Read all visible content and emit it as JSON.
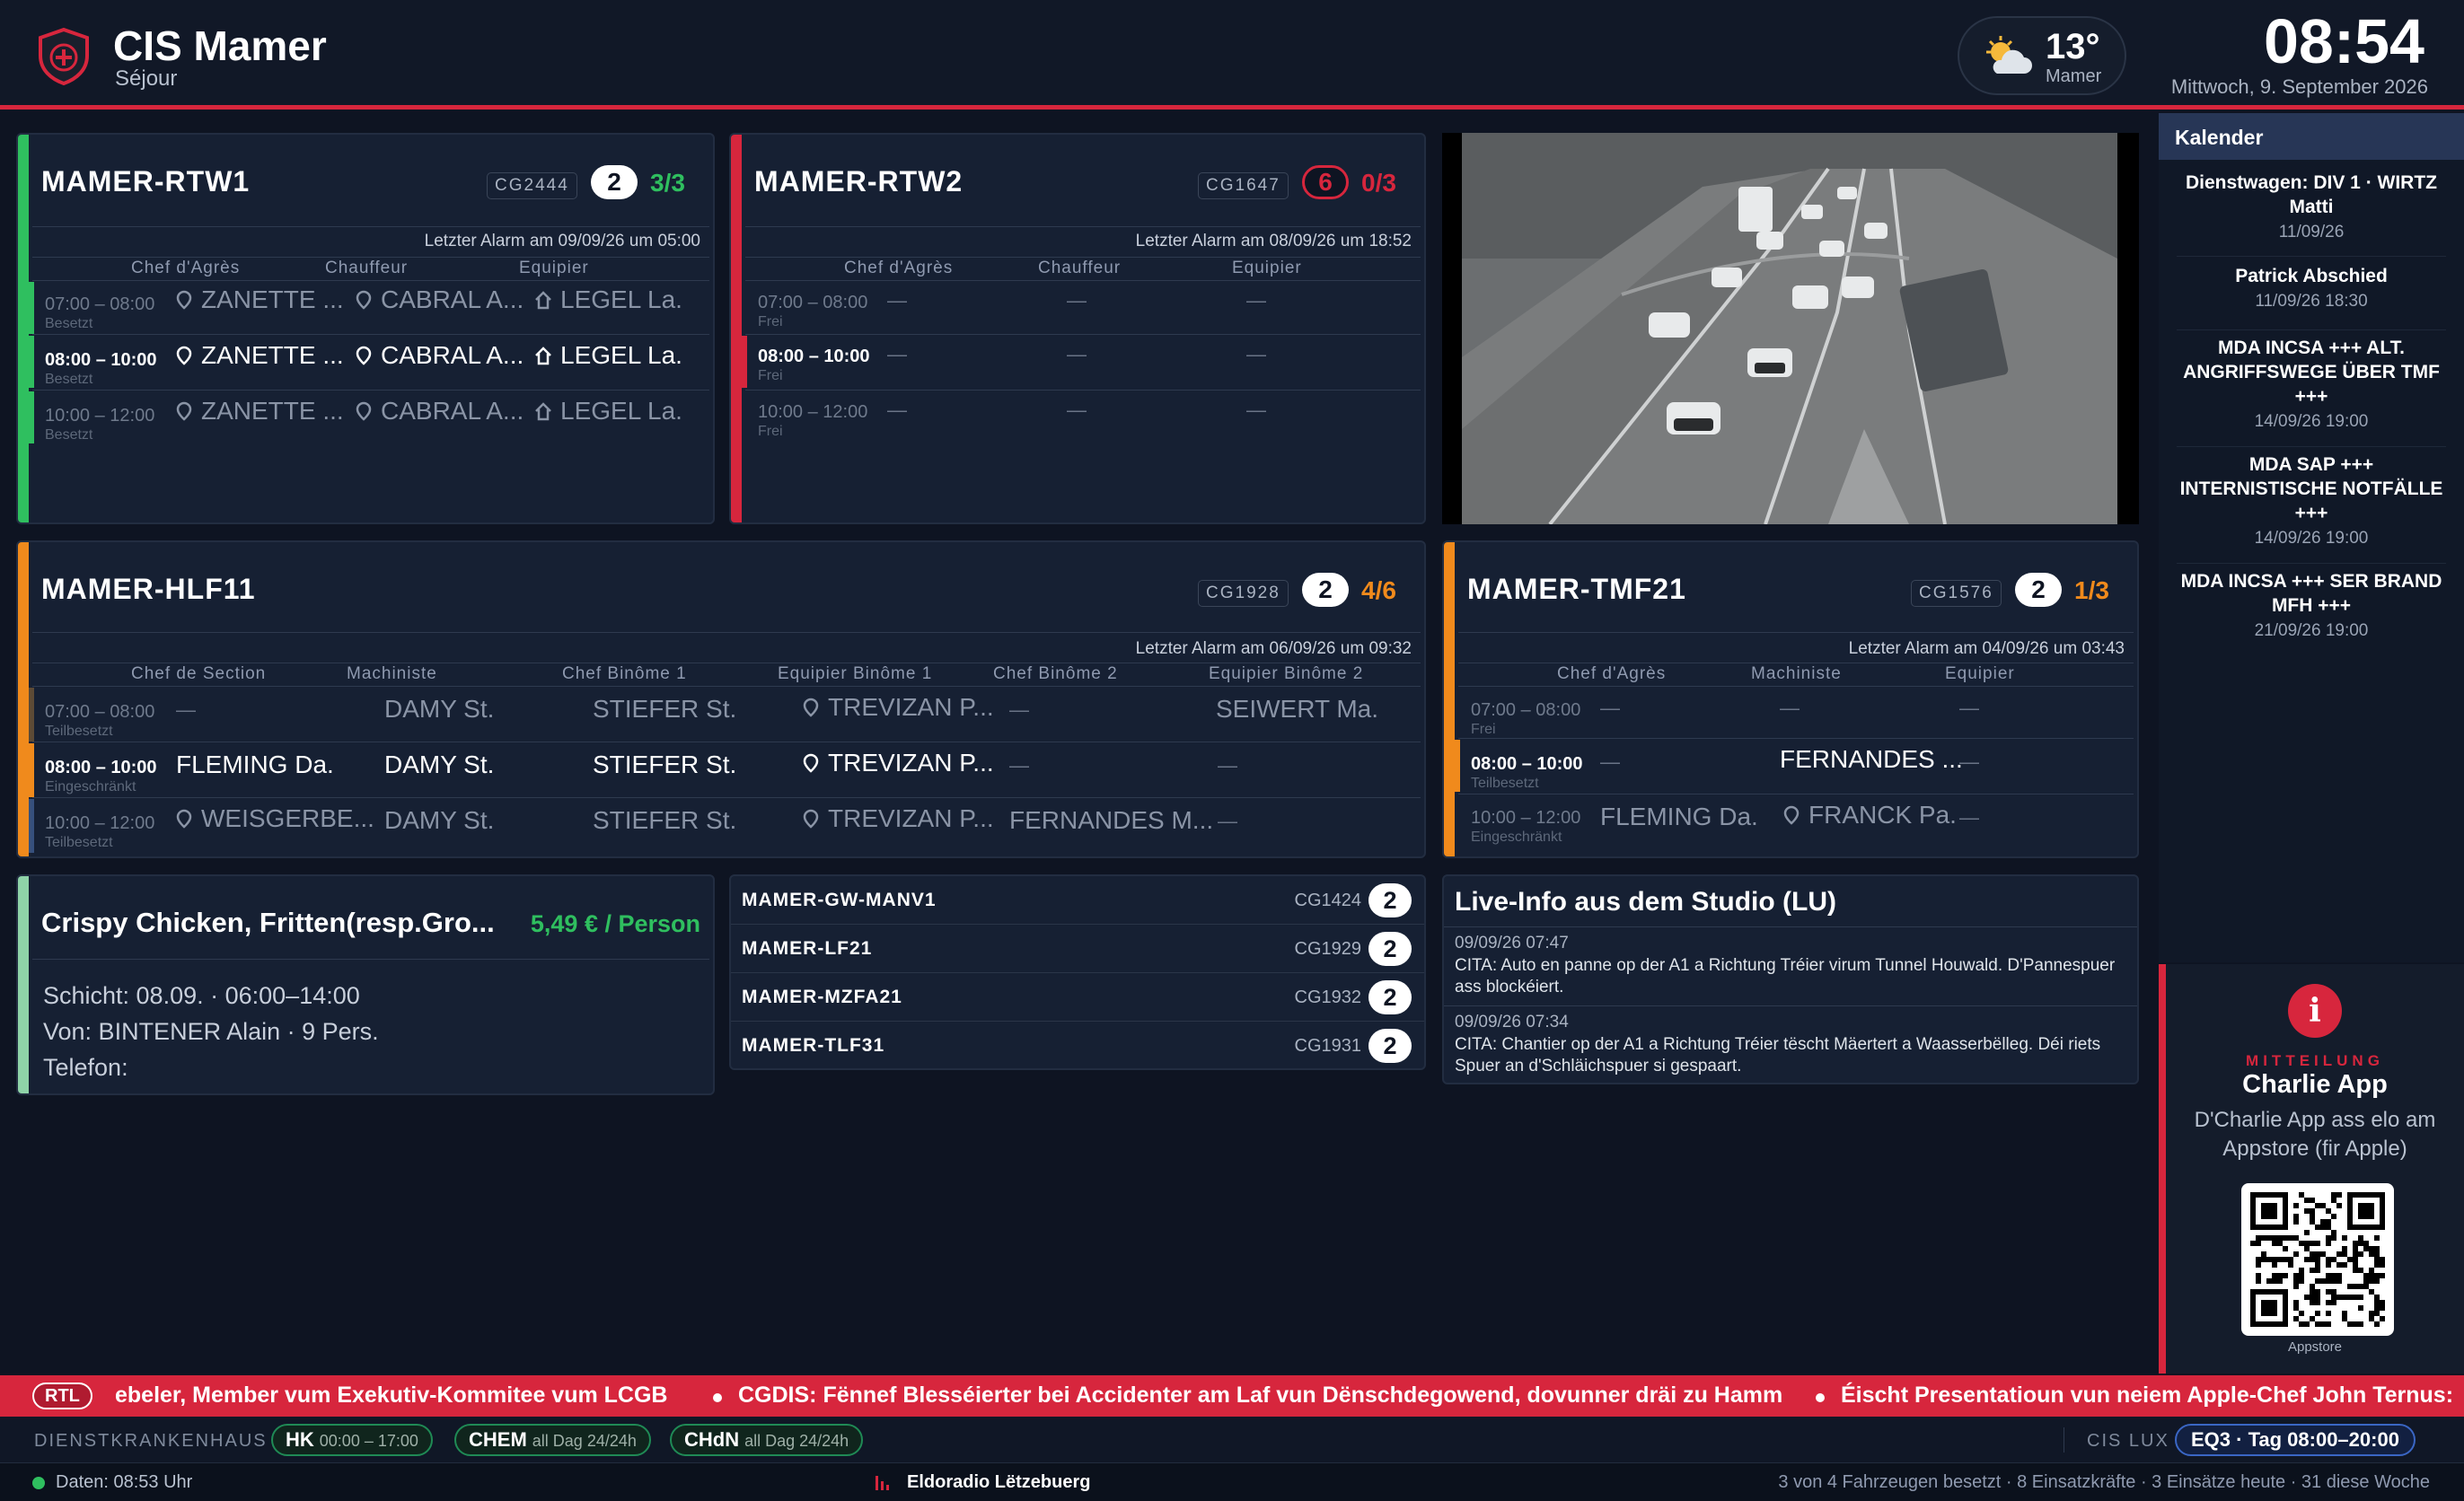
{
  "header": {
    "station": "CIS Mamer",
    "mode": "Séjour",
    "weather": {
      "temp": "13°",
      "location": "Mamer",
      "icon": "partly-cloudy-icon"
    },
    "clock": "08:54",
    "date": "Mittwoch, 9. September 2026"
  },
  "colors": {
    "accent": "#d7263d",
    "ok": "#2fbf5f",
    "warn": "#f08a1c",
    "alert": "#d7263d"
  },
  "vehicles": {
    "rtw1": {
      "name": "MAMER-RTW1",
      "cg": "CG2444",
      "count": "2",
      "ratio": "3/3",
      "last": "Letzter Alarm am 09/09/26 um 05:00",
      "cols": [
        "Chef d'Agrès",
        "Chauffeur",
        "Equipier"
      ],
      "rows": [
        {
          "time": "07:00 – 08:00",
          "status": "Besetzt",
          "c": [
            "ZANETTE ...",
            "CABRAL A...",
            "LEGEL La."
          ]
        },
        {
          "time": "08:00 – 10:00",
          "status": "Besetzt",
          "c": [
            "ZANETTE ...",
            "CABRAL A...",
            "LEGEL La."
          ]
        },
        {
          "time": "10:00 – 12:00",
          "status": "Besetzt",
          "c": [
            "ZANETTE ...",
            "CABRAL A...",
            "LEGEL La."
          ]
        }
      ]
    },
    "rtw2": {
      "name": "MAMER-RTW2",
      "cg": "CG1647",
      "count": "6",
      "ratio": "0/3",
      "last": "Letzter Alarm am 08/09/26 um 18:52",
      "cols": [
        "Chef d'Agrès",
        "Chauffeur",
        "Equipier"
      ],
      "rows": [
        {
          "time": "07:00 – 08:00",
          "status": "Frei"
        },
        {
          "time": "08:00 – 10:00",
          "status": "Frei"
        },
        {
          "time": "10:00 – 12:00",
          "status": "Frei"
        }
      ],
      "empty": "—"
    },
    "hlf11": {
      "name": "MAMER-HLF11",
      "cg": "CG1928",
      "count": "2",
      "ratio": "4/6",
      "last": "Letzter Alarm am 06/09/26 um 09:32",
      "cols": [
        "Chef de Section",
        "Machiniste",
        "Chef Binôme 1",
        "Equipier Binôme 1",
        "Chef Binôme 2",
        "Equipier Binôme 2"
      ],
      "rows": [
        {
          "time": "07:00 – 08:00",
          "status": "Teilbesetzt",
          "c": [
            "—",
            "DAMY St.",
            "STIEFER St.",
            "TREVIZAN P...",
            "—",
            "SEIWERT Ma."
          ]
        },
        {
          "time": "08:00 – 10:00",
          "status": "Eingeschränkt",
          "c": [
            "FLEMING Da.",
            "DAMY St.",
            "STIEFER St.",
            "TREVIZAN P...",
            "—",
            "—"
          ]
        },
        {
          "time": "10:00 – 12:00",
          "status": "Teilbesetzt",
          "c": [
            "WEISGERBE...",
            "DAMY St.",
            "STIEFER St.",
            "TREVIZAN P...",
            "FERNANDES M...",
            "—"
          ]
        }
      ]
    },
    "tmf21": {
      "name": "MAMER-TMF21",
      "cg": "CG1576",
      "count": "2",
      "ratio": "1/3",
      "last": "Letzter Alarm am 04/09/26 um 03:43",
      "cols": [
        "Chef d'Agrès",
        "Machiniste",
        "Equipier"
      ],
      "rows": [
        {
          "time": "07:00 – 08:00",
          "status": "Frei",
          "c": [
            "—",
            "—",
            "—"
          ]
        },
        {
          "time": "08:00 – 10:00",
          "status": "Teilbesetzt",
          "c": [
            "—",
            "FERNANDES ...",
            "—"
          ]
        },
        {
          "time": "10:00 – 12:00",
          "status": "Eingeschränkt",
          "c": [
            "FLEMING Da.",
            "FRANCK Pa.",
            "—"
          ]
        }
      ]
    }
  },
  "meal": {
    "title": "Crispy Chicken, Fritten(resp.Gro...",
    "price": "5,49 € / Person",
    "shift": "Schicht: 08.09. · 06:00–14:00",
    "by": "Von: BINTENER Alain · 9 Pers.",
    "phone": "Telefon:"
  },
  "others": [
    {
      "name": "MAMER-GW-MANV1",
      "cg": "CG1424",
      "count": "2"
    },
    {
      "name": "MAMER-LF21",
      "cg": "CG1929",
      "count": "2"
    },
    {
      "name": "MAMER-MZFA21",
      "cg": "CG1932",
      "count": "2"
    },
    {
      "name": "MAMER-TLF31",
      "cg": "CG1931",
      "count": "2"
    }
  ],
  "live": {
    "title": "Live-Info aus dem Studio (LU)",
    "items": [
      {
        "time": "09/09/26 07:47",
        "text": "CITA: Auto en panne op der A1 a Richtung Tréier virum Tunnel Houwald. D'Pannespuer ass blockéiert."
      },
      {
        "time": "09/09/26 07:34",
        "text": "CITA: Chantier op der A1 a Richtung Tréier tëscht Mäertert a Waasserbëlleg. Déi riets Spuer an d'Schläichspuer si gespaart."
      }
    ]
  },
  "calendar": {
    "title": "Kalender",
    "items": [
      {
        "t": "Dienstwagen: DIV 1 · WIRTZ Matti",
        "d": "11/09/26"
      },
      {
        "t": "Patrick Abschied",
        "d": "11/09/26 18:30"
      },
      {
        "t": "MDA INCSA +++ ALT. ANGRIFFSWEGE ÜBER TMF +++",
        "d": "14/09/26 19:00"
      },
      {
        "t": "MDA SAP +++ INTERNISTISCHE NOTFÄLLE +++",
        "d": "14/09/26 19:00"
      },
      {
        "t": "MDA INCSA +++ SER BRAND MFH +++",
        "d": "21/09/26 19:00"
      }
    ]
  },
  "notice": {
    "label": "MITTEILUNG",
    "title": "Charlie App",
    "text": "D'Charlie App ass elo am Appstore (fir Apple)",
    "qr_caption": "Appstore"
  },
  "ticker": {
    "source": "RTL",
    "items": [
      "ebeler, Member vum Exekutiv-Kommitee vum LCGB",
      "CGDIS: Fënnef Blesséierter bei Accidenter am Laf vun Dënschdegowend, dovunner dräi zu Hamm",
      "Éischt Presentatioun vun neiem Apple-Chef John Ternus:"
    ]
  },
  "hospital": {
    "label": "DIENSTKRANKENHAUS",
    "pills": [
      {
        "k": "HK",
        "v": "00:00 – 17:00"
      },
      {
        "k": "CHEM",
        "v": "all Dag 24/24h"
      },
      {
        "k": "CHdN",
        "v": "all Dag 24/24h"
      }
    ],
    "cislux_label": "CIS LUX",
    "cislux_value": "EQ3 · Tag 08:00–20:00"
  },
  "status": {
    "data": "Daten: 08:53 Uhr",
    "radio": "Eldoradio Lëtzebuerg",
    "summary": "3 von 4 Fahrzeugen besetzt · 8 Einsatzkräfte · 3 Einsätze heute · 31 diese Woche"
  }
}
